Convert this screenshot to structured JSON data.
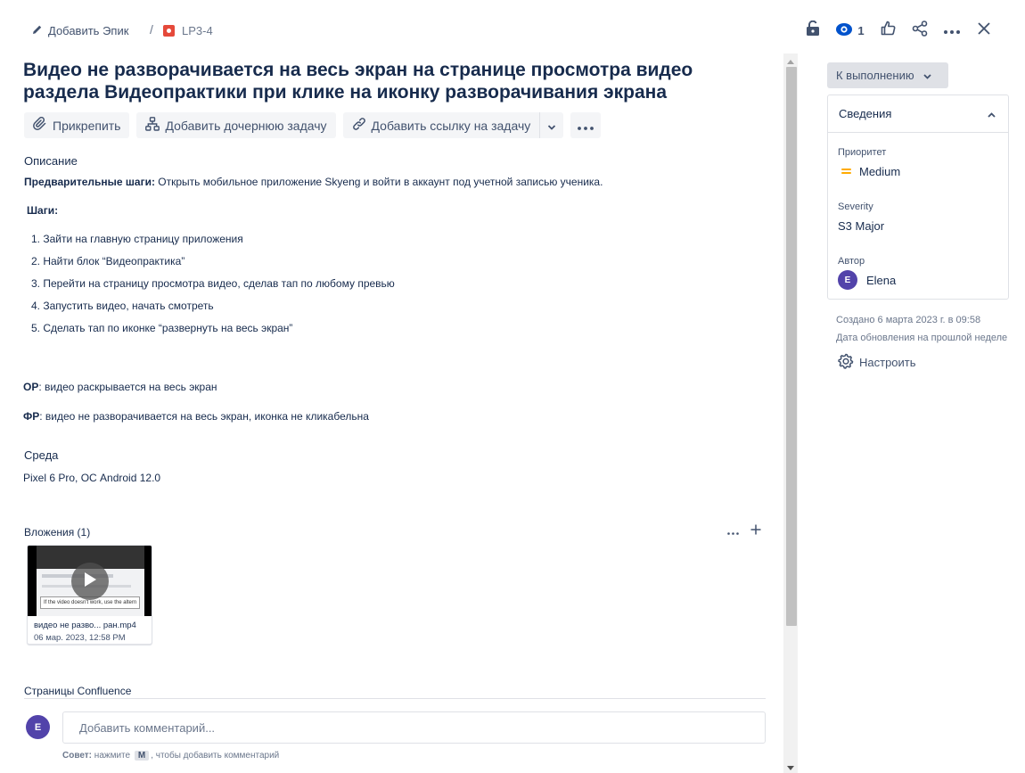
{
  "breadcrumb": {
    "add_epic": "Добавить Эпик",
    "separator": "/",
    "issue_key": "LP3-4"
  },
  "top_actions": {
    "watchers_count": "1"
  },
  "issue": {
    "title": "Видео не разворачивается на весь экран на странице просмотра видео раздела Видеопрактики при клике на иконку разворачивания экрана"
  },
  "toolbar": {
    "attach": "Прикрепить",
    "add_child": "Добавить дочернюю задачу",
    "link_issue": "Добавить ссылку на задачу"
  },
  "description": {
    "heading": "Описание",
    "preconditions_label": "Предварительные шаги:",
    "preconditions_text": " Открыть мобильное приложение Skyeng и войти в аккаунт под учетной записью ученика.",
    "steps_label": "Шаги:",
    "steps": [
      "1. Зайти на главную страницу приложения",
      "2. Найти блок “Видеопрактика”",
      "3. Перейти на страницу просмотра видео, сделав тап по любому превью",
      "4. Запустить видео, начать смотреть",
      "5. Сделать тап по иконке “развернуть на весь экран”"
    ],
    "expected_label": "ОР",
    "expected_text": ": видео раскрывается на весь экран",
    "actual_label": "ФР",
    "actual_text": ": видео не разворачивается на весь экран, иконка не кликабельна"
  },
  "environment": {
    "heading": "Среда",
    "value": "Pixel 6 Pro, ОС Android 12.0"
  },
  "attachments": {
    "heading": "Вложения (1)",
    "items": [
      {
        "name": "видео не разво...  ран.mp4",
        "date": "06 мар. 2023, 12:58 PM",
        "thumb_caption": "If the video doesn't work, use the altern"
      }
    ]
  },
  "confluence": {
    "heading": "Страницы Confluence"
  },
  "comment": {
    "avatar_initial": "E",
    "placeholder": "Добавить комментарий...",
    "tip_label": "Совет:",
    "tip_before": " нажмите ",
    "tip_key": "M",
    "tip_after": ", чтобы добавить комментарий"
  },
  "sidebar": {
    "status": "К выполнению",
    "details_heading": "Сведения",
    "priority_label": "Приоритет",
    "priority_value": "Medium",
    "priority_color": "#ffab00",
    "severity_label": "Severity",
    "severity_value": "S3 Major",
    "reporter_label": "Автор",
    "reporter_initial": "E",
    "reporter_name": "Elena",
    "created": "Создано 6 марта 2023 г. в 09:58",
    "updated": "Дата обновления на прошлой неделе",
    "configure": "Настроить"
  },
  "colors": {
    "avatar": "#5243aa",
    "bug": "#e5493a",
    "text": "#172b4d"
  }
}
